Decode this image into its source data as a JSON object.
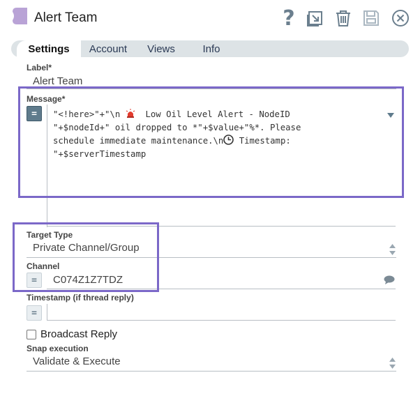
{
  "header": {
    "title": "Alert Team",
    "icons": [
      "help-icon",
      "export-icon",
      "delete-icon",
      "save-icon",
      "close-icon"
    ],
    "help_label": "?"
  },
  "tabs": [
    {
      "label": "Settings",
      "active": true
    },
    {
      "label": "Account",
      "active": false
    },
    {
      "label": "Views",
      "active": false
    },
    {
      "label": "Info",
      "active": false
    }
  ],
  "form": {
    "label": {
      "name": "Label*",
      "value": "Alert Team"
    },
    "message": {
      "name": "Message*",
      "expression_toggle": "=",
      "line1_prefix": "\"<!here>\"+\"\\n ",
      "line1_suffix": "  Low Oil Level Alert - NodeID",
      "line2": "\"+$nodeId+\" oil dropped to *\"+$value+\"%*. Please",
      "line3_prefix": "schedule immediate maintenance.\\n",
      "line3_suffix": " Timestamp:",
      "line4": "\"+$serverTimestamp"
    },
    "target_type": {
      "name": "Target Type",
      "value": "Private Channel/Group"
    },
    "channel": {
      "name": "Channel",
      "expression_toggle": "=",
      "value": "C074Z1Z7TDZ"
    },
    "timestamp": {
      "name": "Timestamp (if thread reply)",
      "expression_toggle": "=",
      "value": ""
    },
    "broadcast_reply": {
      "label": "Broadcast Reply",
      "checked": false
    },
    "snap_execution": {
      "name": "Snap execution",
      "value": "Validate & Execute"
    }
  },
  "colors": {
    "highlight_border": "#7b68c8",
    "title_shape": "#b9a3d6",
    "icon": "#6b7f8e",
    "tab_bar": "#dde3e6"
  }
}
